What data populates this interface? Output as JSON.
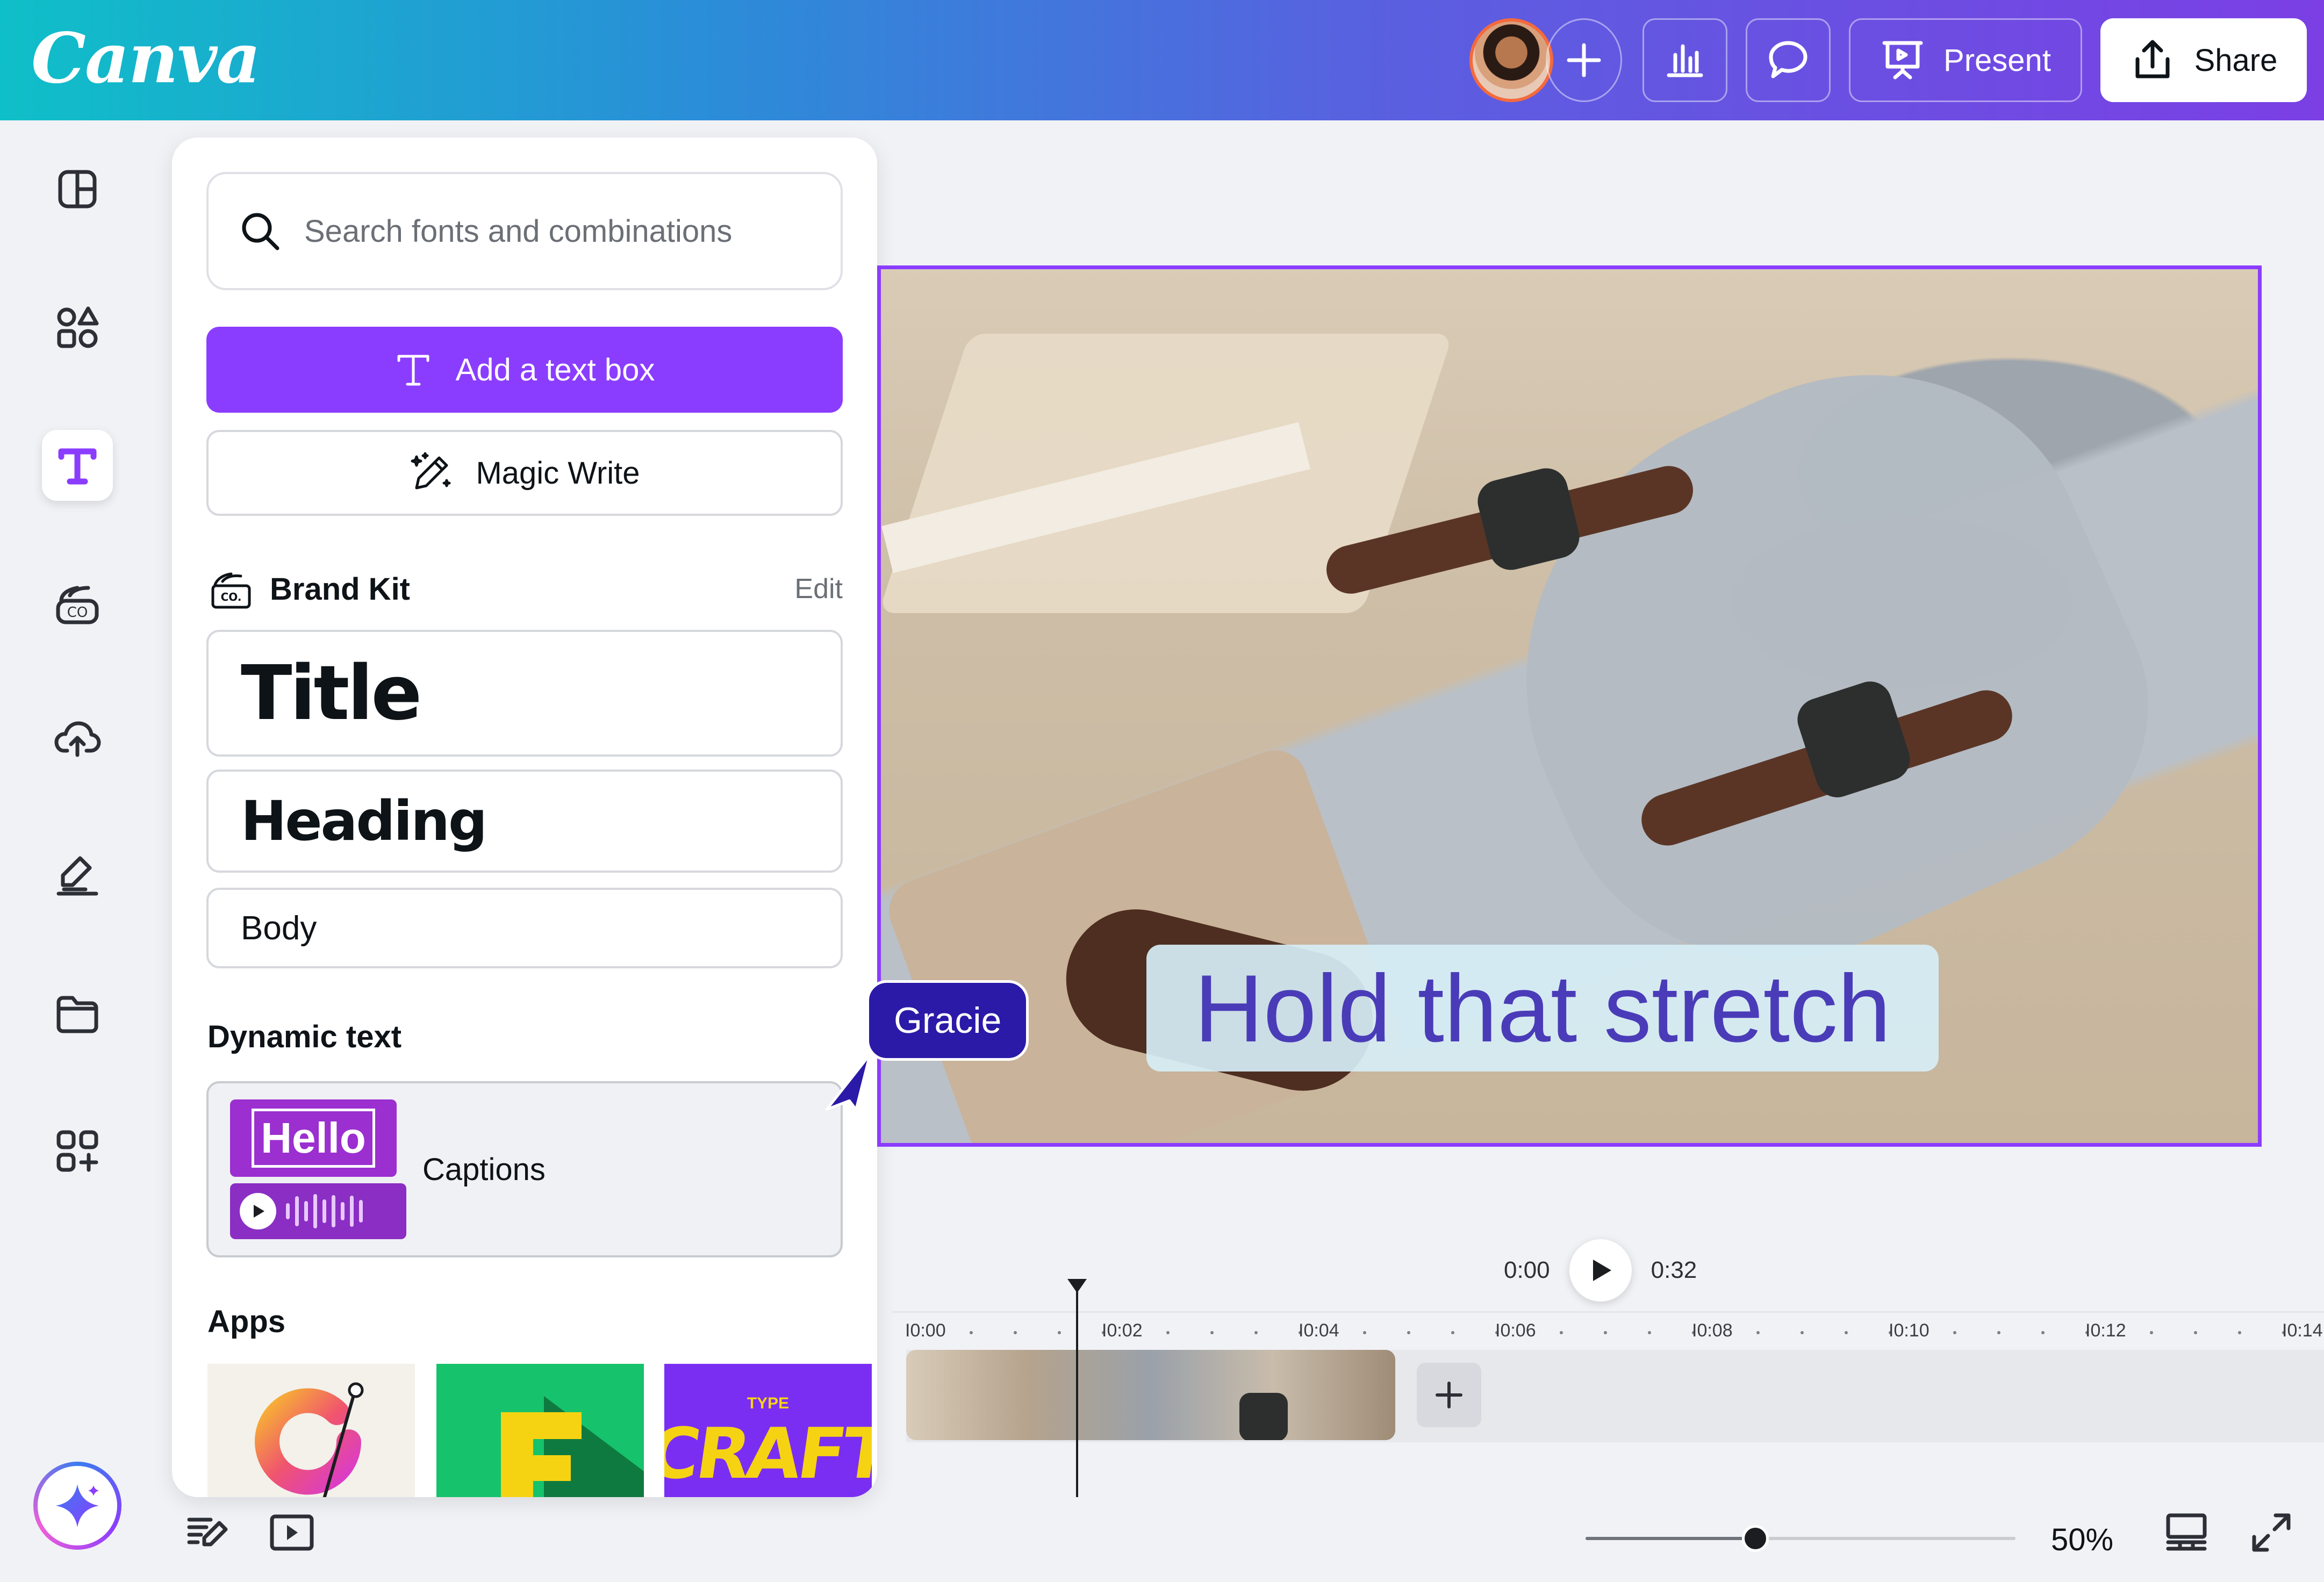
{
  "header": {
    "logo": "Canva",
    "present_label": "Present",
    "share_label": "Share"
  },
  "rail": {
    "items": [
      "design-icon",
      "elements-icon",
      "text-icon",
      "brand-icon",
      "uploads-icon",
      "draw-icon",
      "projects-icon",
      "apps-icon"
    ],
    "active": "text-icon"
  },
  "panel": {
    "search_placeholder": "Search fonts and combinations",
    "add_text_label": "Add a text box",
    "magic_write_label": "Magic Write",
    "brand_kit_label": "Brand Kit",
    "brand_kit_logo": "CO.",
    "edit_label": "Edit",
    "title_label": "Title",
    "heading_label": "Heading",
    "body_label": "Body",
    "dynamic_text_label": "Dynamic text",
    "captions_thumb_text": "Hello",
    "captions_label": "Captions",
    "apps_label": "Apps",
    "app_tiles": [
      "grammar-app",
      "font-app",
      "type-craft-app"
    ],
    "craft_top": "TYPE",
    "craft_main": "CRAFT"
  },
  "canvas": {
    "caption_text": "Hold that stretch",
    "collaborator_name": "Gracie"
  },
  "timeline": {
    "current_time": "0:00",
    "total_time": "0:32",
    "ruler_labels": [
      "I0:00",
      "I0:02",
      "I0:04",
      "I0:06",
      "I0:08",
      "I0:10",
      "I0:12",
      "I0:14"
    ]
  },
  "footer": {
    "zoom_label": "50%",
    "zoom_level": 0.5
  },
  "colors": {
    "accent": "#8b3dff",
    "collaborator": "#2b1aa8",
    "caption_text": "#4a3cb8"
  }
}
